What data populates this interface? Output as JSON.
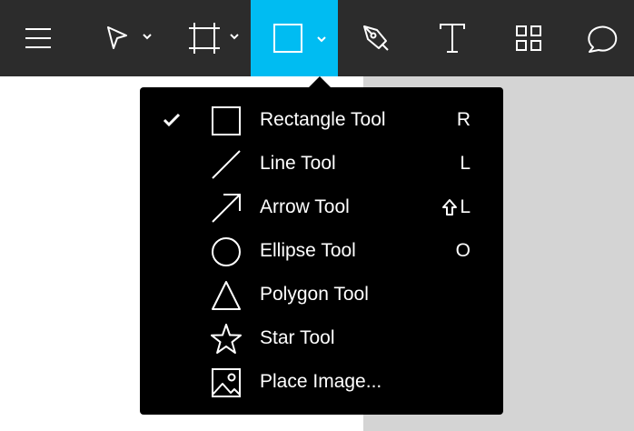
{
  "toolbar": {
    "menu_icon": "hamburger-icon",
    "tools": [
      {
        "icon": "move-cursor-icon",
        "has_dropdown": true
      },
      {
        "icon": "frame-icon",
        "has_dropdown": true
      },
      {
        "icon": "rectangle-icon",
        "has_dropdown": true,
        "active": true
      },
      {
        "icon": "pen-icon",
        "has_dropdown": false
      },
      {
        "icon": "text-icon",
        "has_dropdown": false
      },
      {
        "icon": "components-icon",
        "has_dropdown": false
      },
      {
        "icon": "comment-icon",
        "has_dropdown": false
      }
    ],
    "active_color": "#00bcf2",
    "background_color": "#2c2c2c"
  },
  "shape_menu": {
    "items": [
      {
        "label": "Rectangle Tool",
        "shortcut": "R",
        "icon": "rectangle-icon",
        "checked": true
      },
      {
        "label": "Line Tool",
        "shortcut": "L",
        "icon": "line-icon",
        "checked": false
      },
      {
        "label": "Arrow Tool",
        "shortcut": "L",
        "shortcut_modifier": "shift-icon",
        "icon": "arrow-icon",
        "checked": false
      },
      {
        "label": "Ellipse Tool",
        "shortcut": "O",
        "icon": "ellipse-icon",
        "checked": false
      },
      {
        "label": "Polygon Tool",
        "shortcut": "",
        "icon": "polygon-icon",
        "checked": false
      },
      {
        "label": "Star Tool",
        "shortcut": "",
        "icon": "star-icon",
        "checked": false
      },
      {
        "label": "Place Image...",
        "shortcut": "",
        "icon": "image-icon",
        "checked": false
      }
    ]
  }
}
